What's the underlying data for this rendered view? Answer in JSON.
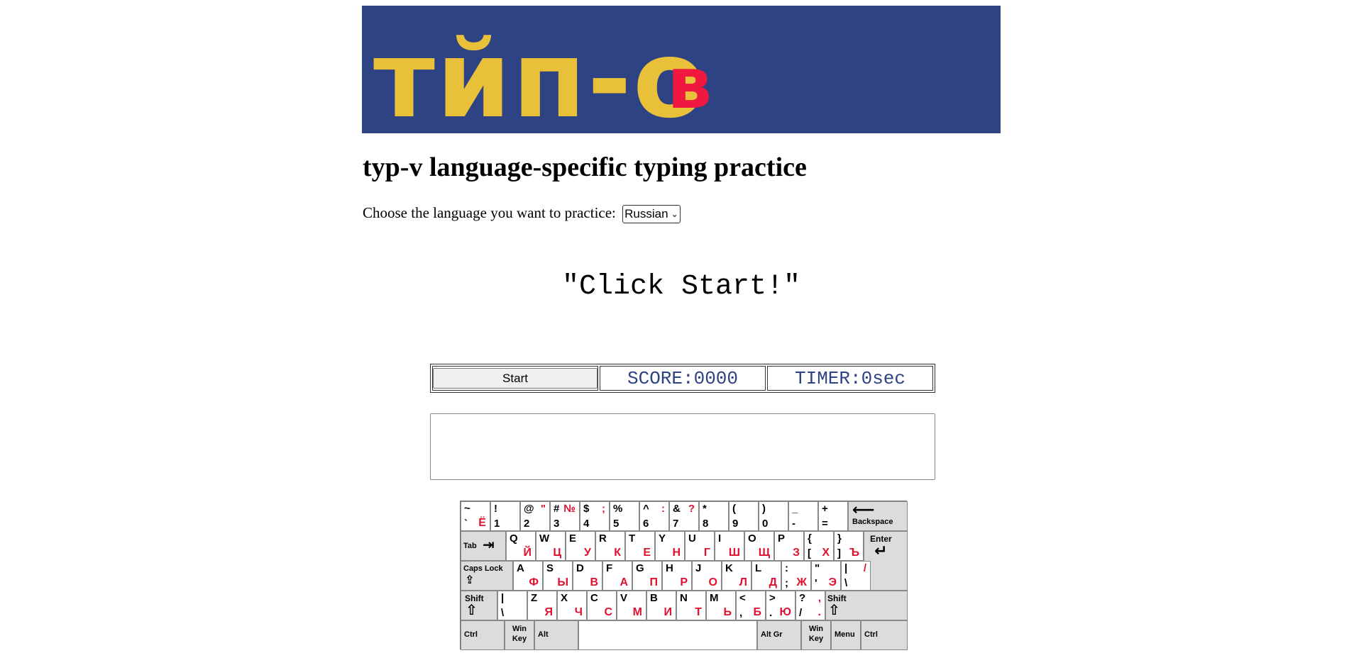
{
  "banner": {
    "logo_text": "тйп-о",
    "logo_sup": "в",
    "bg_color": "#2e4384",
    "logo_color": "#e8c03a",
    "accent_color": "#f01740"
  },
  "page_title": "typ-v language-specific typing practice",
  "language_selector": {
    "label": "Choose the language you want to practice:",
    "selected": "Russian"
  },
  "prompt": "\"Click Start!\"",
  "controls": {
    "start_label": "Start",
    "score_label": "SCORE:0000",
    "timer_label": "TIMER:0sec"
  },
  "keyboard": {
    "row1": [
      {
        "tl": "~",
        "bl": "`",
        "tr": "",
        "br": "Ё"
      },
      {
        "tl": "!",
        "bl": "1",
        "tr": "",
        "br": ""
      },
      {
        "tl": "@",
        "bl": "2",
        "tr": "\"",
        "br": ""
      },
      {
        "tl": "#",
        "bl": "3",
        "tr": "№",
        "br": ""
      },
      {
        "tl": "$",
        "bl": "4",
        "tr": ";",
        "br": ""
      },
      {
        "tl": "%",
        "bl": "5",
        "tr": "",
        "br": ""
      },
      {
        "tl": "^",
        "bl": "6",
        "tr": ":",
        "br": ""
      },
      {
        "tl": "&",
        "bl": "7",
        "tr": "?",
        "br": ""
      },
      {
        "tl": "*",
        "bl": "8",
        "tr": "",
        "br": ""
      },
      {
        "tl": "(",
        "bl": "9",
        "tr": "",
        "br": ""
      },
      {
        "tl": ")",
        "bl": "0",
        "tr": "",
        "br": ""
      },
      {
        "tl": "_",
        "bl": "-",
        "tr": "",
        "br": ""
      },
      {
        "tl": "+",
        "bl": "=",
        "tr": "",
        "br": ""
      }
    ],
    "backspace": "Backspace",
    "tab": "Tab",
    "row2": [
      {
        "tl": "Q",
        "br": "Й"
      },
      {
        "tl": "W",
        "br": "Ц"
      },
      {
        "tl": "E",
        "br": "У"
      },
      {
        "tl": "R",
        "br": "К"
      },
      {
        "tl": "T",
        "br": "Е"
      },
      {
        "tl": "Y",
        "br": "Н"
      },
      {
        "tl": "U",
        "br": "Г"
      },
      {
        "tl": "I",
        "br": "Ш"
      },
      {
        "tl": "O",
        "br": "Щ"
      },
      {
        "tl": "P",
        "br": "З"
      },
      {
        "tl": "{",
        "bl": "[",
        "br": "Х"
      },
      {
        "tl": "}",
        "bl": "]",
        "br": "Ъ"
      }
    ],
    "enter": "Enter",
    "caps": "Caps Lock",
    "row3": [
      {
        "tl": "A",
        "br": "Ф"
      },
      {
        "tl": "S",
        "br": "Ы"
      },
      {
        "tl": "D",
        "br": "В"
      },
      {
        "tl": "F",
        "br": "А"
      },
      {
        "tl": "G",
        "br": "П"
      },
      {
        "tl": "H",
        "br": "Р"
      },
      {
        "tl": "J",
        "br": "О"
      },
      {
        "tl": "K",
        "br": "Л"
      },
      {
        "tl": "L",
        "br": "Д"
      },
      {
        "tl": ":",
        "bl": ";",
        "br": "Ж"
      },
      {
        "tl": "\"",
        "bl": "'",
        "br": "Э"
      },
      {
        "tl": "|",
        "bl": "\\",
        "tr": "/",
        "br": ""
      }
    ],
    "shift": "Shift",
    "row4": [
      {
        "tl": "|",
        "bl": "\\",
        "br": ""
      },
      {
        "tl": "Z",
        "br": "Я"
      },
      {
        "tl": "X",
        "br": "Ч"
      },
      {
        "tl": "C",
        "br": "С"
      },
      {
        "tl": "V",
        "br": "М"
      },
      {
        "tl": "B",
        "br": "И"
      },
      {
        "tl": "N",
        "br": "Т"
      },
      {
        "tl": "M",
        "br": "Ь"
      },
      {
        "tl": "<",
        "bl": ",",
        "br": "Б"
      },
      {
        "tl": ">",
        "bl": ".",
        "br": "Ю"
      },
      {
        "tl": "?",
        "bl": "/",
        "tr": ",",
        "br": "."
      }
    ],
    "ctrl": "Ctrl",
    "win_key": "Win Key",
    "alt": "Alt",
    "alt_gr": "Alt Gr",
    "menu": "Menu"
  }
}
